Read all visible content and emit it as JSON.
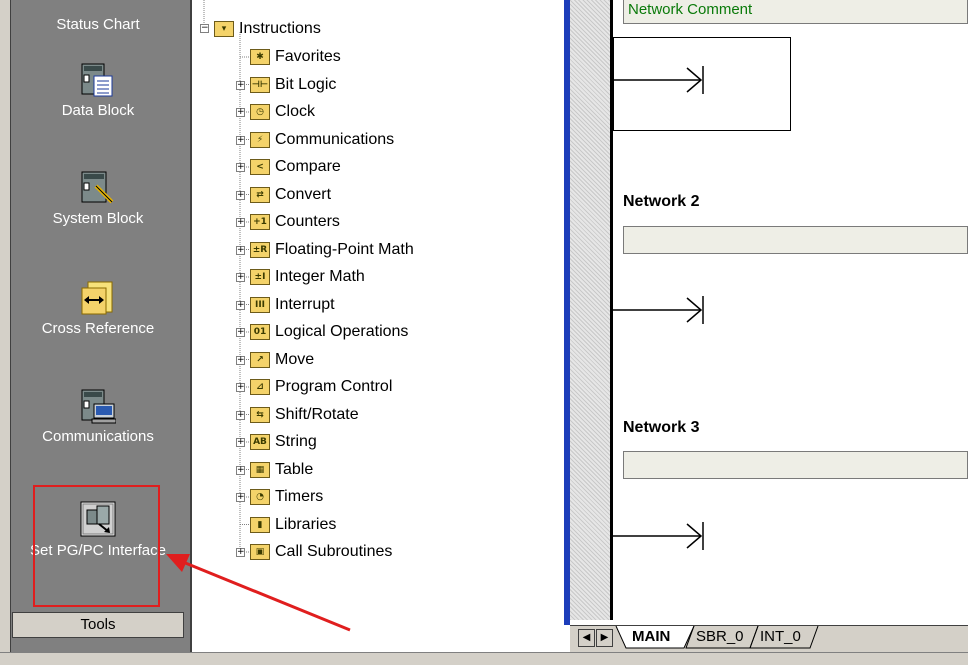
{
  "navbar": {
    "items": [
      {
        "label": "Status Chart"
      },
      {
        "label": "Data Block"
      },
      {
        "label": "System Block"
      },
      {
        "label": "Cross Reference"
      },
      {
        "label": "Communications"
      },
      {
        "label": "Set PG/PC Interface"
      }
    ],
    "group_label": "Tools"
  },
  "tree": {
    "root_label": "Instructions",
    "items": [
      {
        "label": "Favorites",
        "icon": "star-folder-icon",
        "glyph": "✱",
        "expandable": false
      },
      {
        "label": "Bit Logic",
        "icon": "bit-logic-icon",
        "glyph": "⊣⊢",
        "expandable": true
      },
      {
        "label": "Clock",
        "icon": "clock-icon",
        "glyph": "◷",
        "expandable": true
      },
      {
        "label": "Communications",
        "icon": "communications-icon",
        "glyph": "⚡",
        "expandable": true
      },
      {
        "label": "Compare",
        "icon": "compare-icon",
        "glyph": "<",
        "expandable": true
      },
      {
        "label": "Convert",
        "icon": "convert-icon",
        "glyph": "⇄",
        "expandable": true
      },
      {
        "label": "Counters",
        "icon": "counters-icon",
        "glyph": "+1",
        "expandable": true
      },
      {
        "label": "Floating-Point Math",
        "icon": "floating-point-icon",
        "glyph": "±R",
        "expandable": true
      },
      {
        "label": "Integer Math",
        "icon": "integer-math-icon",
        "glyph": "±I",
        "expandable": true
      },
      {
        "label": "Interrupt",
        "icon": "interrupt-icon",
        "glyph": "III",
        "expandable": true
      },
      {
        "label": "Logical Operations",
        "icon": "logical-ops-icon",
        "glyph": "01",
        "expandable": true
      },
      {
        "label": "Move",
        "icon": "move-icon",
        "glyph": "↗",
        "expandable": true
      },
      {
        "label": "Program Control",
        "icon": "program-control-icon",
        "glyph": "⊿",
        "expandable": true
      },
      {
        "label": "Shift/Rotate",
        "icon": "shift-rotate-icon",
        "glyph": "⇆",
        "expandable": true
      },
      {
        "label": "String",
        "icon": "string-icon",
        "glyph": "AB",
        "expandable": true
      },
      {
        "label": "Table",
        "icon": "table-icon",
        "glyph": "▦",
        "expandable": true
      },
      {
        "label": "Timers",
        "icon": "timers-icon",
        "glyph": "◔",
        "expandable": true
      },
      {
        "label": "Libraries",
        "icon": "libraries-icon",
        "glyph": "▮",
        "expandable": false
      },
      {
        "label": "Call Subroutines",
        "icon": "call-subroutines-icon",
        "glyph": "▣",
        "expandable": true
      }
    ]
  },
  "editor": {
    "network1_comment": "Network Comment",
    "network2_title": "Network 2",
    "network3_title": "Network 3"
  },
  "tabs": [
    {
      "label": "MAIN",
      "active": true
    },
    {
      "label": "SBR_0",
      "active": false
    },
    {
      "label": "INT_0",
      "active": false
    }
  ],
  "colors": {
    "highlight": "#e01e1e",
    "navbar": "#808080",
    "comment_text": "#0a7a0a"
  }
}
